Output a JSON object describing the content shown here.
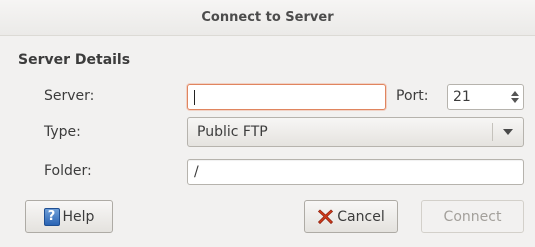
{
  "window": {
    "title": "Connect to Server"
  },
  "section": {
    "heading": "Server Details"
  },
  "server": {
    "label": "Server:",
    "value": ""
  },
  "port": {
    "label": "Port:",
    "value": "21"
  },
  "type": {
    "label": "Type:",
    "selected": "Public FTP"
  },
  "folder": {
    "label": "Folder:",
    "value": "/"
  },
  "buttons": {
    "help": "Help",
    "cancel": "Cancel",
    "connect": "Connect"
  },
  "icons": {
    "help": "help-icon",
    "cancel": "cancel-icon",
    "spin_up": "chevron-up-icon",
    "spin_down": "chevron-down-icon",
    "dropdown": "chevron-down-icon"
  },
  "colors": {
    "focus_border": "#e0855f",
    "help_icon": "#2a64b4",
    "cancel_icon": "#d43b1a",
    "disabled_text": "#a3a09b"
  }
}
